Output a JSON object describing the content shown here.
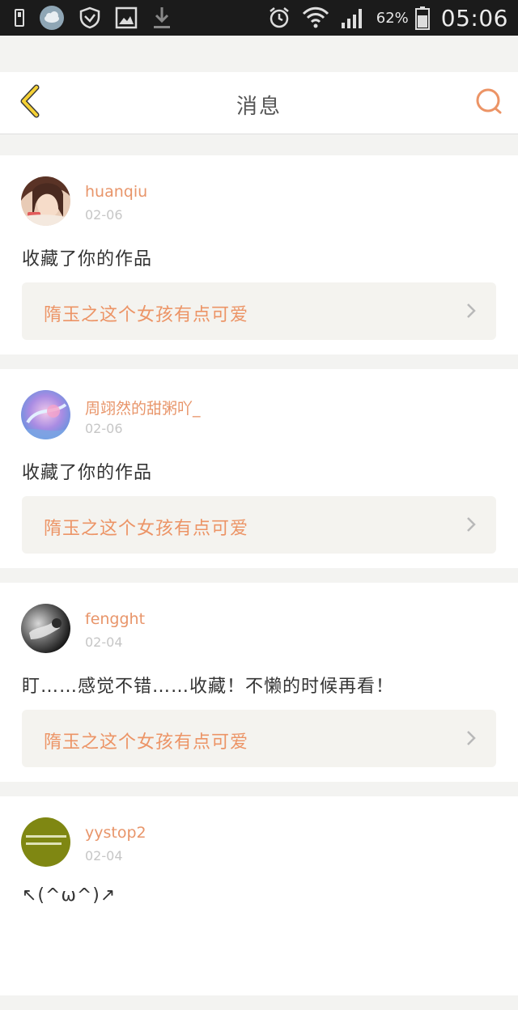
{
  "status_bar": {
    "battery_percent": "62%",
    "time": "05:06",
    "icons": [
      "sim-icon",
      "weather-cloud-icon",
      "shield-icon",
      "image-icon",
      "download-icon",
      "alarm-icon",
      "wifi-icon",
      "signal-icon",
      "battery-icon"
    ]
  },
  "header": {
    "title": "消息",
    "back_icon": "chevron-left-icon",
    "search_icon": "search-icon"
  },
  "messages": [
    {
      "username": "huanqiu",
      "date": "02-06",
      "text": "收藏了你的作品",
      "work_title": "隋玉之这个女孩有点可爱",
      "avatar_colors": [
        "#f3d9c8",
        "#6b4032"
      ]
    },
    {
      "username": "周翊然的甜粥吖_",
      "date": "02-06",
      "text": "收藏了你的作品",
      "work_title": "隋玉之这个女孩有点可爱",
      "avatar_colors": [
        "#c9a7e6",
        "#6aa7e0"
      ]
    },
    {
      "username": "fengght",
      "date": "02-04",
      "text": "盯……感觉不错……收藏！不懒的时候再看！",
      "work_title": "隋玉之这个女孩有点可爱",
      "avatar_colors": [
        "#bdbdbd",
        "#1c1c1c"
      ]
    },
    {
      "username": "yystop2",
      "date": "02-04",
      "text": "↖(^ω^)↗",
      "avatar_colors": [
        "#8a8a1a",
        "#5f6a0e"
      ]
    }
  ],
  "colors": {
    "accent": "#ec9466",
    "username": "#e8956a",
    "back_icon": "#f5d135",
    "date": "#c6c6c6"
  }
}
